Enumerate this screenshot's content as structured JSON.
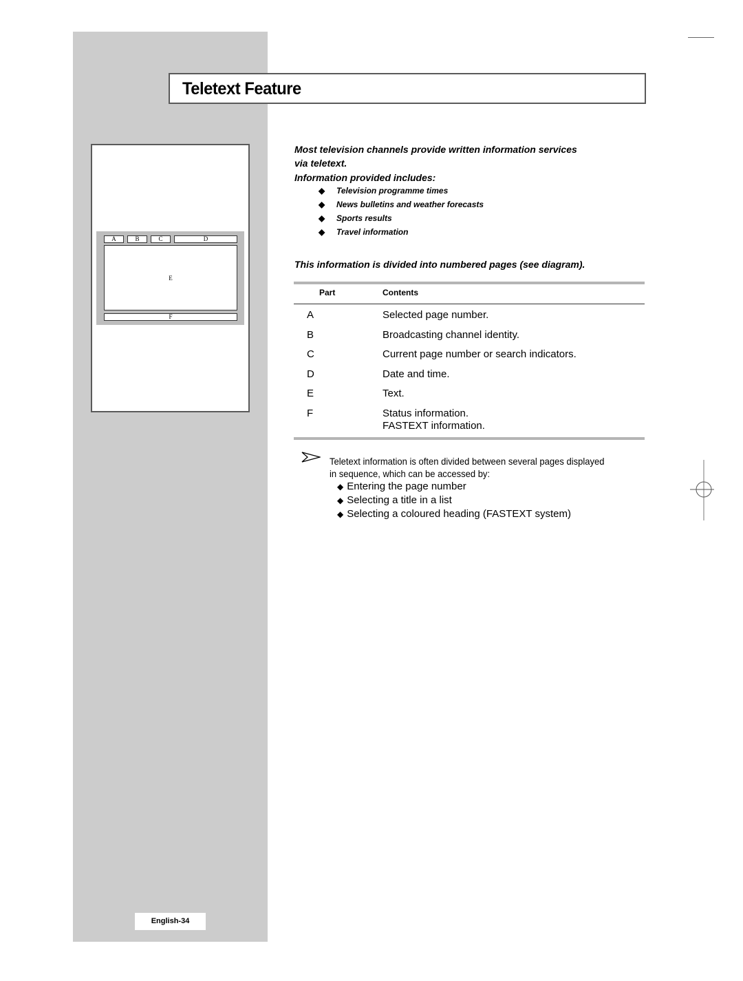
{
  "header": {
    "title": "Teletext Feature"
  },
  "diagram": {
    "labels": {
      "a": "A",
      "b": "B",
      "c": "C",
      "d": "D",
      "e": "E",
      "f": "F"
    }
  },
  "intro": {
    "line1": "Most television channels provide written information services",
    "line2": "via teletext.",
    "line3": "Information provided includes:",
    "bullet_icon": "diamond-bullet",
    "bullets": [
      "Television programme times",
      "News bulletins and weather forecasts",
      "Sports results",
      "Travel information"
    ],
    "divided_note": "This information is divided into numbered pages (see diagram)."
  },
  "table": {
    "headers": {
      "part": "Part",
      "contents": "Contents"
    },
    "rows": [
      {
        "part": "A",
        "contents": "Selected page number."
      },
      {
        "part": "B",
        "contents": "Broadcasting channel identity."
      },
      {
        "part": "C",
        "contents": "Current page number or search indicators."
      },
      {
        "part": "D",
        "contents": "Date and time."
      },
      {
        "part": "E",
        "contents": "Text."
      },
      {
        "part": "F",
        "contents": "Status information.",
        "contents2": "FASTEXT information."
      }
    ]
  },
  "note": {
    "icon": "arrow-note-icon",
    "line1": "Teletext information is often divided between several pages displayed",
    "line2": "in sequence, which can be accessed by:",
    "bullets": [
      "Entering the page number",
      "Selecting a title in a list",
      "Selecting a coloured heading (FASTEXT system)"
    ]
  },
  "footer": {
    "page_label": "English-34"
  },
  "colors": {
    "sidebar": "#cccccc",
    "border": "#5a5a5a",
    "rule": "#b5b5b5"
  }
}
